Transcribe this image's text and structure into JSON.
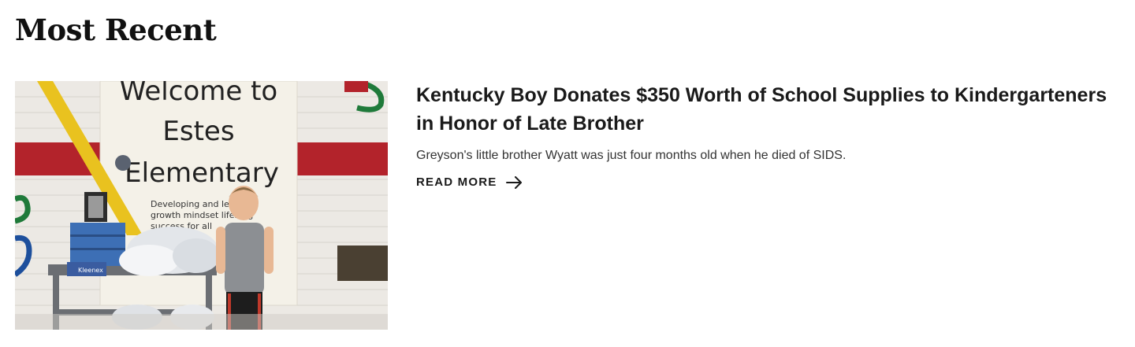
{
  "section": {
    "title": "Most Recent"
  },
  "article": {
    "headline": "Kentucky Boy Donates $350 Worth of School Supplies to Kindergarteners in Honor of Late Brother",
    "excerpt": "Greyson's little brother Wyatt was just four months old when he died of SIDS.",
    "read_more_label": "READ MORE",
    "read_more_icon": "arrow-right-icon",
    "image": {
      "sign_lines": [
        "Welcome to",
        "Estes",
        "Elementary"
      ],
      "sign_subtext": [
        "Developing and leading",
        "growth mindset lifelong",
        "success for all"
      ],
      "tissue_brand": "Kleenex"
    }
  }
}
